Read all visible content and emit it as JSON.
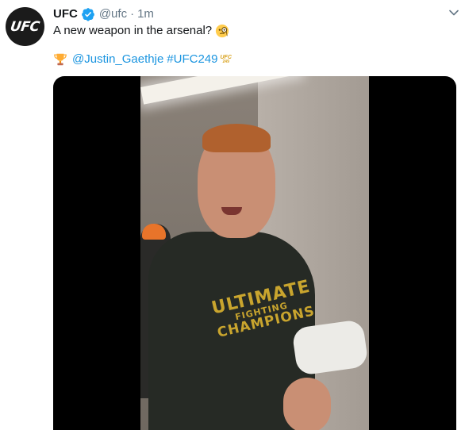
{
  "author": {
    "display_name": "UFC",
    "handle": "@ufc",
    "separator": "·",
    "timestamp": "1m",
    "avatar_text": "UFC",
    "verified": true
  },
  "tweet": {
    "text": "A new weapon in the arsenal?",
    "emoji": "monocle-face-emoji",
    "trophy_emoji": "trophy-emoji",
    "mention": "@Justin_Gaethje",
    "hashtag": "#UFC249",
    "hashflag_top": "UFC",
    "hashflag_bottom": "249"
  },
  "media": {
    "type": "video",
    "shirt_lines": [
      "ULTIMATE",
      "FIGHTING",
      "CHAMPIONS"
    ]
  },
  "colors": {
    "link": "#1b95e0",
    "verified": "#1da1f2",
    "text": "#14171a",
    "muted": "#657786"
  },
  "icons": {
    "verified": "verified-badge-icon",
    "caret": "chevron-down-icon"
  }
}
